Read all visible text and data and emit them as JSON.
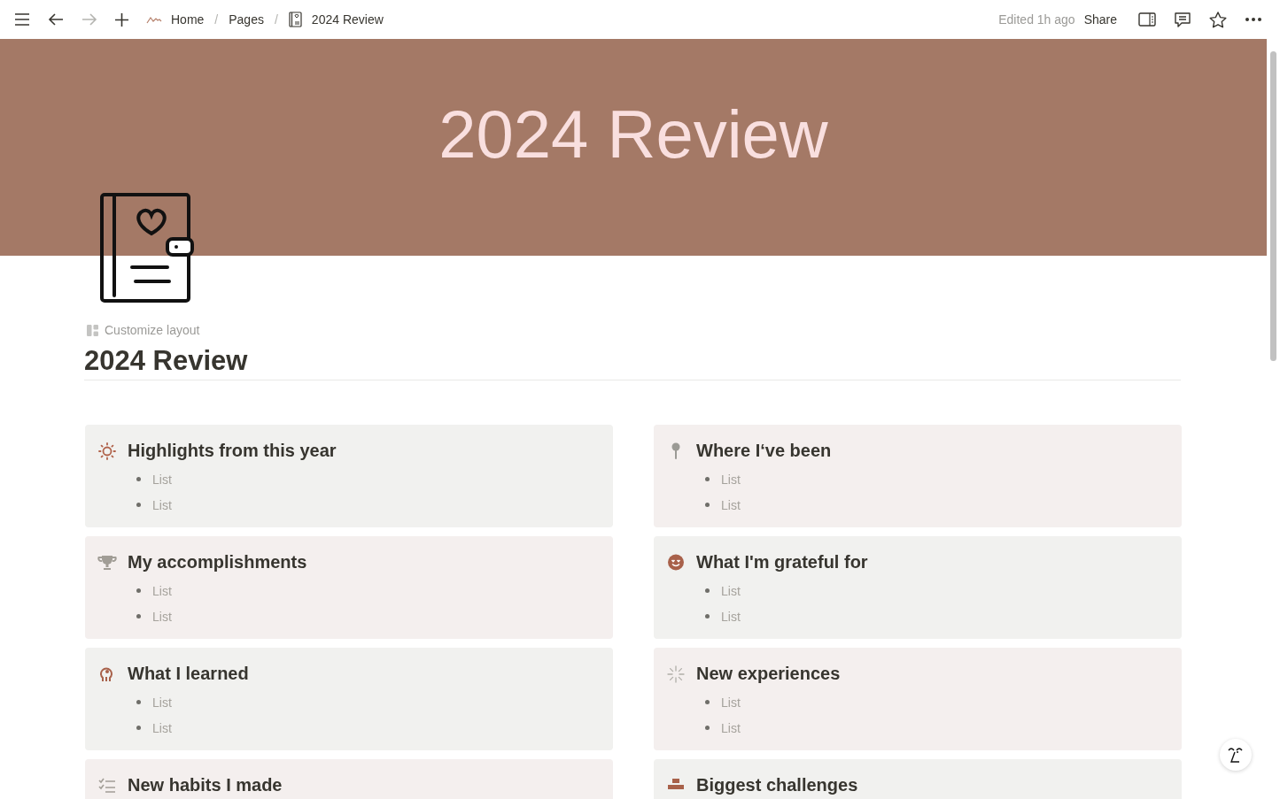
{
  "topbar": {
    "breadcrumbs": [
      {
        "label": "Home"
      },
      {
        "label": "Pages"
      },
      {
        "label": "2024 Review"
      }
    ],
    "separators": [
      "/",
      "/"
    ],
    "edited": "Edited 1h ago",
    "share": "Share"
  },
  "cover": {
    "title": "2024 Review"
  },
  "customize": "Customize layout",
  "title": "2024 Review",
  "cards": [
    {
      "title": "Highlights from this year",
      "color": "#f1f1ef",
      "items": [
        "List",
        "List"
      ]
    },
    {
      "title": "Where I‘ve been",
      "color": "#f4efee",
      "items": [
        "List",
        "List"
      ]
    },
    {
      "title": "My accomplishments",
      "color": "#f4efee",
      "items": [
        "List",
        "List"
      ]
    },
    {
      "title": "What I'm grateful for",
      "color": "#f1f1ef",
      "items": [
        "List",
        "List"
      ]
    },
    {
      "title": "What I learned",
      "color": "#f1f1ef",
      "items": [
        "List",
        "List"
      ]
    },
    {
      "title": "New experiences",
      "color": "#f4efee",
      "items": [
        "List",
        "List"
      ]
    },
    {
      "title": "New habits I made",
      "color": "#f4efee"
    },
    {
      "title": "Biggest challenges",
      "color": "#f1f1ef"
    }
  ]
}
